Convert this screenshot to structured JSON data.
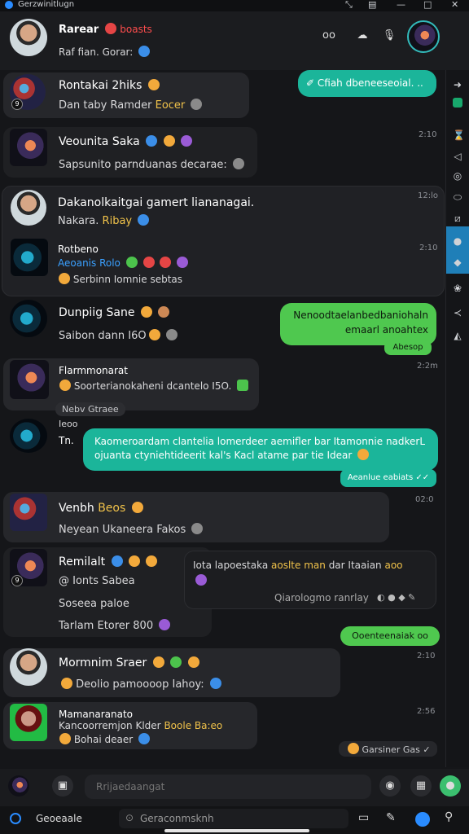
{
  "titlebar": {
    "title": "Gerzwinitlugn",
    "min": "⤡",
    "doc": "▤",
    "max": "□",
    "close": "✕"
  },
  "header": {
    "name": "Rarear",
    "name_extra": "boasts",
    "status": "Raf fian. Gorar:",
    "badge": "oo"
  },
  "chats": [
    {
      "name": "Rontakai 2hiks",
      "sub_a": "Dan taby Ramder",
      "sub_b": "Eocer",
      "status": "9"
    },
    {
      "name": "Veounita Saka",
      "sub": "Sapsunito parnduanas decarae:",
      "time": "2:10"
    },
    {
      "name": "Dakanolkaitgai gamert liananagai.",
      "sub_a": "Nakara.",
      "sub_b": "Ribay",
      "time": "12:lo"
    },
    {
      "name": "Rotbeno",
      "sub": "Aeoanis Rolo",
      "line": "Serbinn Iomnie sebtas",
      "time": "2:10"
    },
    {
      "name": "Dunpiig Sane",
      "sub": "Saibon dann I6O",
      "status": ""
    },
    {
      "name": "Flarmmonarat",
      "sub": "Soorterianokaheni dcantelo I5O.",
      "time": "2:2m",
      "tag": "Nebv Gtraee"
    },
    {
      "name": "Tn.",
      "label": "Ieoo"
    },
    {
      "name": "Venbh",
      "name_b": "Beos",
      "sub": "Neyean Ukaneera Fakos",
      "time": "02:0"
    },
    {
      "name": "Remilalt",
      "sub": "Ionts Sabea",
      "sub2": "Soseea paloe",
      "sub3": "Tarlam Etorer",
      "sub3_b": "800",
      "status": "9"
    },
    {
      "name": "Mormnim Sraer",
      "sub": "Deolio pamoooop Iahoy:",
      "time": "2:10"
    },
    {
      "name": "Mamanaranato",
      "sub": "Kancoorremjon Klder",
      "sub_b": "Boole Ba:eo",
      "line": "Bohai deaer",
      "time": "2:56"
    }
  ],
  "messages": {
    "m1": "Cfiah dbeneeseoial.",
    "m1_end": "..",
    "m2": "Nenoodtaelanbedbaniohaln emaarl anoahtex",
    "m2_time": "Abesop",
    "m3": "Kaomeroardam clantelia lomerdeer aemifler bar Itamonnie nadkerL ojuanta ctyniehtideerit kal's Kacl atame par tie Idear",
    "m3_time": "Aeanlue eabiats",
    "quote_a": "Iota lapoestaka",
    "quote_b": "aoslte man",
    "quote_c": "dar Itaaian",
    "quote_d": "aoo",
    "quote_meta": "Qiarologmo ranrlay",
    "m4": "Ooenteenaiak",
    "m4_b": "oo",
    "m5": "Garsiner Gas"
  },
  "composer": {
    "placeholder": "Rrijaedaangat"
  },
  "bottombar": {
    "left": "Geoeaale",
    "search": "Geraconmsknh"
  }
}
